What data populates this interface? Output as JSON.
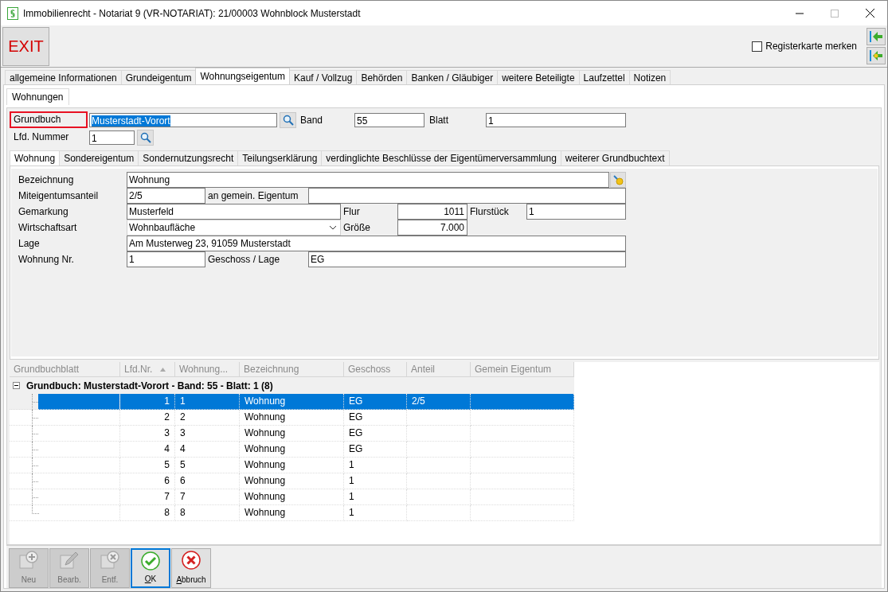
{
  "window": {
    "title": "Immobilienrecht - Notariat 9 (VR-NOTARIAT): 21/00003 Wohnblock Musterstadt"
  },
  "toolbar": {
    "exit_button": "EXIT",
    "remember_tab": {
      "label": "Registerkarte merken",
      "checked": false
    }
  },
  "main_tabs": [
    {
      "label": "allgemeine Informationen",
      "selected": false
    },
    {
      "label": "Grundeigentum",
      "selected": false
    },
    {
      "label": "Wohnungseigentum",
      "selected": true
    },
    {
      "label": "Kauf / Vollzug",
      "selected": false
    },
    {
      "label": "Behörden",
      "selected": false
    },
    {
      "label": "Banken / Gläubiger",
      "selected": false
    },
    {
      "label": "weitere Beteiligte",
      "selected": false
    },
    {
      "label": "Laufzettel",
      "selected": false
    },
    {
      "label": "Notizen",
      "selected": false
    }
  ],
  "sub_tabs": [
    {
      "label": "Wohnungen",
      "selected": true
    }
  ],
  "header": {
    "grundbuch": {
      "label": "Grundbuch",
      "value": "Musterstadt-Vorort",
      "text_highlighted": true,
      "focused": true
    },
    "band": {
      "label": "Band",
      "value": "55"
    },
    "blatt": {
      "label": "Blatt",
      "value": "1"
    },
    "lfd_nummer": {
      "label": "Lfd. Nummer",
      "value": "1"
    }
  },
  "inner_tabs": [
    {
      "label": "Wohnung",
      "selected": true
    },
    {
      "label": "Sondereigentum",
      "selected": false
    },
    {
      "label": "Sondernutzungsrecht",
      "selected": false
    },
    {
      "label": "Teilungserklärung",
      "selected": false
    },
    {
      "label": "verdinglichte Beschlüsse der Eigentümerversammlung",
      "selected": false
    },
    {
      "label": "weiterer Grundbuchtext",
      "selected": false
    }
  ],
  "form": {
    "bezeichnung": {
      "label": "Bezeichnung",
      "value": "Wohnung"
    },
    "miteigentumsanteil": {
      "label": "Miteigentumsanteil",
      "value": "2/5"
    },
    "gemein_eigentum": {
      "label": "an gemein. Eigentum"
    },
    "gemarkung": {
      "label": "Gemarkung",
      "value": "Musterfeld"
    },
    "flur": {
      "label": "Flur",
      "value": "1011"
    },
    "flurstueck": {
      "label": "Flurstück",
      "value": "1"
    },
    "wirtschaftsart": {
      "label": "Wirtschaftsart",
      "value": "Wohnbaufläche"
    },
    "groesse": {
      "label": "Größe",
      "value": "7.000"
    },
    "lage": {
      "label": "Lage",
      "value": "Am Musterweg 23, 91059 Musterstadt"
    },
    "wohnung_nr": {
      "label": "Wohnung Nr.",
      "value": "1"
    },
    "geschoss": {
      "label": "Geschoss / Lage",
      "value": "EG"
    }
  },
  "grid": {
    "columns": [
      {
        "label": "Grundbuchblatt",
        "sorted": false
      },
      {
        "label": "Lfd.Nr.",
        "sorted": true
      },
      {
        "label": "Wohnung...",
        "sorted": false
      },
      {
        "label": "Bezeichnung",
        "sorted": false
      },
      {
        "label": "Geschoss",
        "sorted": false
      },
      {
        "label": "Anteil",
        "sorted": false
      },
      {
        "label": "Gemein Eigentum",
        "sorted": false
      }
    ],
    "group": {
      "label": "Grundbuch: Musterstadt-Vorort - Band: 55 - Blatt: 1 (8)",
      "expanded": true
    },
    "rows": [
      {
        "lfd_nr": "1",
        "wohnung": "1",
        "bezeichnung": "Wohnung",
        "geschoss": "EG",
        "anteil": "2/5",
        "selected": true
      },
      {
        "lfd_nr": "2",
        "wohnung": "2",
        "bezeichnung": "Wohnung",
        "geschoss": "EG",
        "selected": false
      },
      {
        "lfd_nr": "3",
        "wohnung": "3",
        "bezeichnung": "Wohnung",
        "geschoss": "EG",
        "selected": false
      },
      {
        "lfd_nr": "4",
        "wohnung": "4",
        "bezeichnung": "Wohnung",
        "geschoss": "EG",
        "selected": false
      },
      {
        "lfd_nr": "5",
        "wohnung": "5",
        "bezeichnung": "Wohnung",
        "geschoss": "1",
        "selected": false
      },
      {
        "lfd_nr": "6",
        "wohnung": "6",
        "bezeichnung": "Wohnung",
        "geschoss": "1",
        "selected": false
      },
      {
        "lfd_nr": "7",
        "wohnung": "7",
        "bezeichnung": "Wohnung",
        "geschoss": "1",
        "selected": false
      },
      {
        "lfd_nr": "8",
        "wohnung": "8",
        "bezeichnung": "Wohnung",
        "geschoss": "1",
        "selected": false
      }
    ]
  },
  "buttons": [
    {
      "kind": "add",
      "label": "Neu",
      "disabled": true,
      "focused": false
    },
    {
      "kind": "edit",
      "label": "Bearb.",
      "disabled": true,
      "focused": false
    },
    {
      "kind": "delete",
      "label": "Entf.",
      "disabled": true,
      "focused": false
    },
    {
      "kind": "ok",
      "label": "OK",
      "disabled": false,
      "focused": true
    },
    {
      "kind": "cancel",
      "label": "Abbruch",
      "disabled": false,
      "focused": false
    }
  ]
}
